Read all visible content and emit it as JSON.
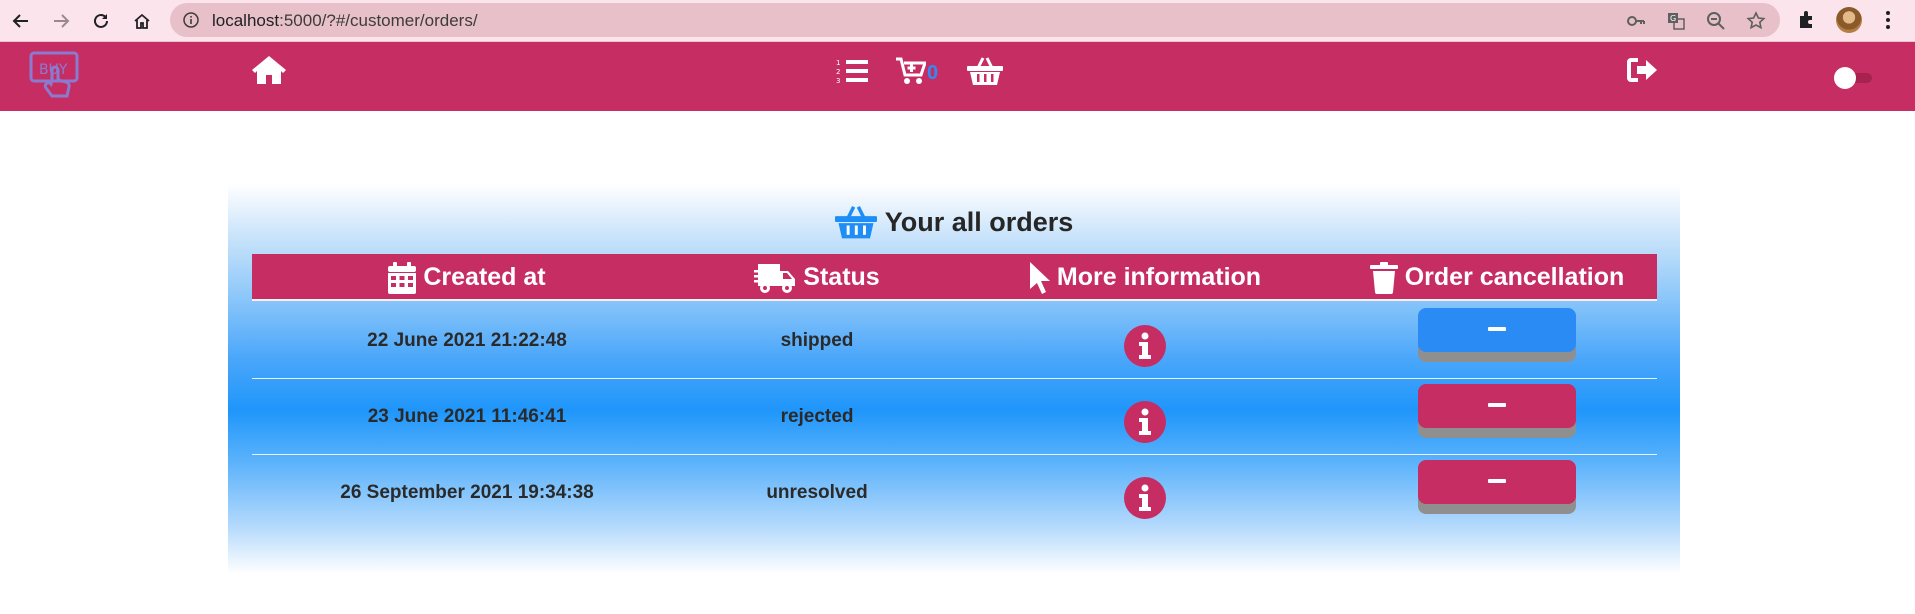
{
  "browser": {
    "url_host": "localhost",
    "url_rest": ":5000/?#/customer/orders/"
  },
  "navbar": {
    "logo_text": "BUY",
    "cart_count": "0",
    "colors": {
      "bar": "#c62d62",
      "cart_count": "#2e8cf2"
    },
    "icons": [
      "home-icon",
      "order-list-icon",
      "cart-icon",
      "basket-icon",
      "logout-icon"
    ]
  },
  "orders": {
    "title": "Your all orders",
    "columns": [
      {
        "label": "Created at",
        "icon": "calendar-icon"
      },
      {
        "label": "Status",
        "icon": "truck-icon"
      },
      {
        "label": "More information",
        "icon": "pointer-icon"
      },
      {
        "label": "Order cancellation",
        "icon": "trash-icon"
      }
    ],
    "rows": [
      {
        "created_at": "22 June 2021 21:22:48",
        "status": "shipped",
        "cancel_color": "#2a8bf5"
      },
      {
        "created_at": "23 June 2021 11:46:41",
        "status": "rejected",
        "cancel_color": "#c62d62"
      },
      {
        "created_at": "26 September 2021 19:34:38",
        "status": "unresolved",
        "cancel_color": "#c62d62"
      }
    ]
  }
}
